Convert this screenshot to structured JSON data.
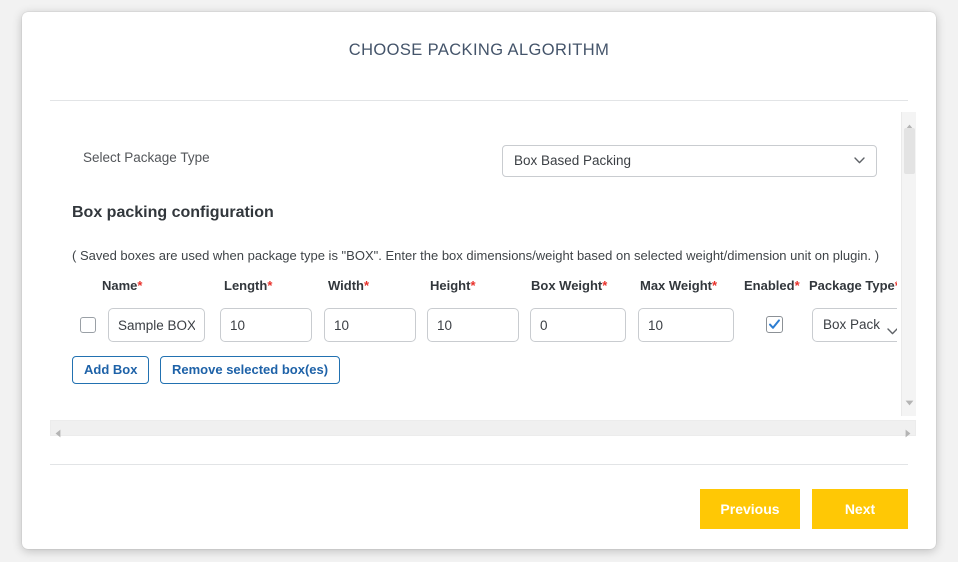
{
  "header": {
    "title": "CHOOSE PACKING ALGORITHM"
  },
  "package_type": {
    "label": "Select Package Type",
    "selected": "Box Based Packing",
    "chevron_icon": "chevron-down-icon"
  },
  "section": {
    "heading": "Box packing configuration",
    "note": "( Saved boxes are used when package type is \"BOX\". Enter the box dimensions/weight based on selected weight/dimension unit on plugin. )"
  },
  "table": {
    "columns": [
      {
        "label": "Name",
        "required": "*"
      },
      {
        "label": "Length",
        "required": "*"
      },
      {
        "label": "Width",
        "required": "*"
      },
      {
        "label": "Height",
        "required": "*"
      },
      {
        "label": "Box Weight",
        "required": "*"
      },
      {
        "label": "Max Weight",
        "required": "*"
      },
      {
        "label": "Enabled",
        "required": "*"
      },
      {
        "label": "Package Type",
        "required": "*"
      }
    ],
    "rows": [
      {
        "selected": false,
        "name": "Sample BOX",
        "length": "10",
        "width": "10",
        "height": "10",
        "box_weight": "0",
        "max_weight": "10",
        "enabled": true,
        "package_type": "Box Pack"
      }
    ]
  },
  "table_actions": {
    "add_box_label": "Add Box",
    "remove_box_label": "Remove selected box(es)"
  },
  "footer": {
    "previous_label": "Previous",
    "next_label": "Next"
  },
  "colors": {
    "title": "#44546a",
    "accent_blue": "#2271b1",
    "required_red": "#e8302a",
    "amber": "#ffc805",
    "checkbox_blue": "#2d7dd2"
  }
}
